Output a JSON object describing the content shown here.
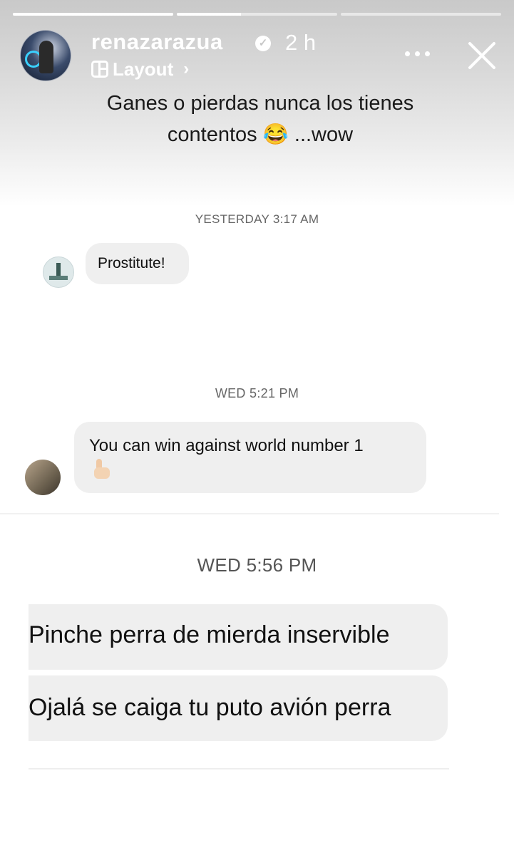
{
  "story": {
    "progress_fill": [
      1.0,
      0.4,
      0.0
    ],
    "username": "renazarazua",
    "verified_icon": "verified-badge-icon",
    "time_ago": "2 h",
    "layout_label": "Layout",
    "caption_line1": "Ganes o pierdas nunca los tienes",
    "caption_line2": "contentos 😂 ...wow"
  },
  "dm1": {
    "timestamp": "YESTERDAY 3:17 AM",
    "message": "Prostitute!"
  },
  "dm2": {
    "timestamp": "WED 5:21 PM",
    "message": "You can win against world number 1",
    "emoji": "👍"
  },
  "dm3": {
    "timestamp": "WED 5:56 PM",
    "message1": "Pinche perra de mierda inservible",
    "message2": "Ojalá se caiga tu puto avión perra"
  },
  "colors": {
    "bubble": "#efefef",
    "timestamp_text": "#666666",
    "header_text": "#ffffff"
  }
}
